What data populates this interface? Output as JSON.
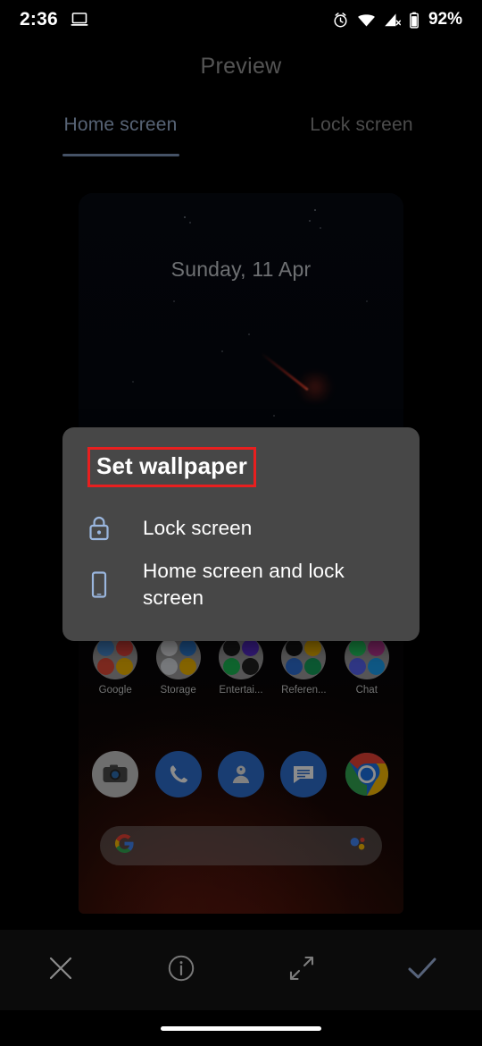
{
  "status_bar": {
    "time": "2:36",
    "battery_percent": "92%",
    "icons": {
      "cast": "laptop-cast-icon",
      "alarm": "alarm-clock-icon",
      "wifi": "wifi-icon",
      "signal": "mobile-signal-off-icon",
      "battery": "battery-icon"
    }
  },
  "header": {
    "title": "Preview"
  },
  "tabs": [
    {
      "label": "Home screen",
      "active": true
    },
    {
      "label": "Lock screen",
      "active": false
    }
  ],
  "preview": {
    "date": "Sunday, 11 Apr",
    "folders": [
      {
        "label": "Google"
      },
      {
        "label": "Storage"
      },
      {
        "label": "Entertai..."
      },
      {
        "label": "Referen..."
      },
      {
        "label": "Chat"
      }
    ],
    "dock": [
      {
        "name": "camera-app-icon"
      },
      {
        "name": "phone-app-icon"
      },
      {
        "name": "contacts-app-icon"
      },
      {
        "name": "messages-app-icon"
      },
      {
        "name": "chrome-app-icon"
      }
    ],
    "search_bar": {
      "value": "",
      "left_icon": "google-g-icon",
      "right_icon": "google-assistant-icon"
    }
  },
  "dialog": {
    "title": "Set wallpaper",
    "highlight_color": "#e81f1f",
    "options": [
      {
        "label": "Lock screen",
        "icon": "lock-icon"
      },
      {
        "label": "Home screen and lock screen",
        "icon": "smartphone-icon"
      }
    ]
  },
  "bottom_bar": {
    "buttons": [
      {
        "name": "close-button",
        "icon": "close-icon"
      },
      {
        "name": "info-button",
        "icon": "info-circle-icon"
      },
      {
        "name": "expand-button",
        "icon": "expand-arrows-icon"
      },
      {
        "name": "confirm-button",
        "icon": "check-icon"
      }
    ]
  },
  "colors": {
    "accent": "#9fb5d6",
    "dialog_bg": "#474747",
    "highlight": "#e81f1f",
    "option_icon": "#9ab6de"
  }
}
